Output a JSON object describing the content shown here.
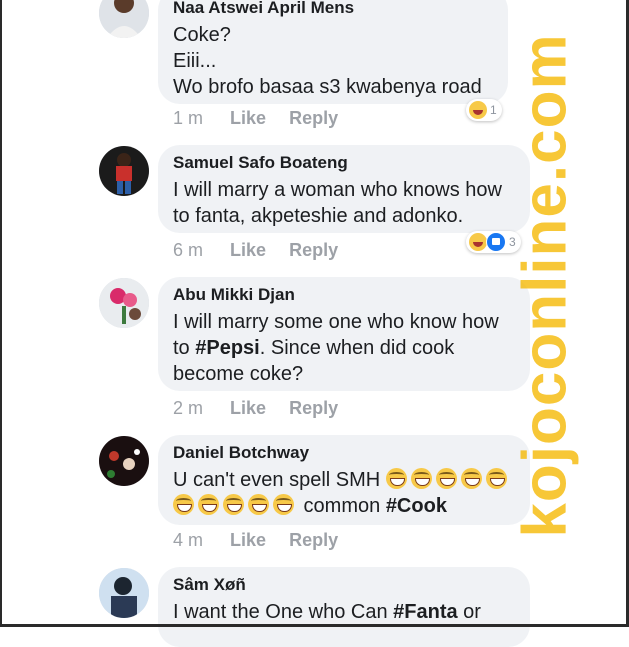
{
  "watermark": "kojoconline.com",
  "actions": {
    "like": "Like",
    "reply": "Reply"
  },
  "comments": [
    {
      "author": "Naa Atswei April Mens",
      "text": "Coke?\nEiii...\nWo brofo basaa s3 kwabenya road",
      "time": "1 m",
      "reaction_count": "1",
      "reactions": [
        "haha"
      ]
    },
    {
      "author": "Samuel Safo Boateng",
      "text": "I will marry a woman who knows how\nto fanta, akpeteshie and adonko.",
      "time": "6 m",
      "reaction_count": "3",
      "reactions": [
        "haha",
        "like"
      ]
    },
    {
      "author": "Abu Mikki Djan",
      "text_before": "I will marry some one who know how\nto ",
      "tag": "#Pepsi",
      "text_after": ". Since when did cook\nbecome coke?",
      "time": "2 m"
    },
    {
      "author": "Daniel Botchway",
      "text_before": "U can't even spell SMH ",
      "text_middle": " common ",
      "tag": "#Cook",
      "emoji": "grinning-squinting-face",
      "time": "4 m"
    },
    {
      "author": "Sâm Xøñ",
      "text_before": "I want the One who Can ",
      "tag": "#Fanta",
      "text_after": " or"
    }
  ]
}
